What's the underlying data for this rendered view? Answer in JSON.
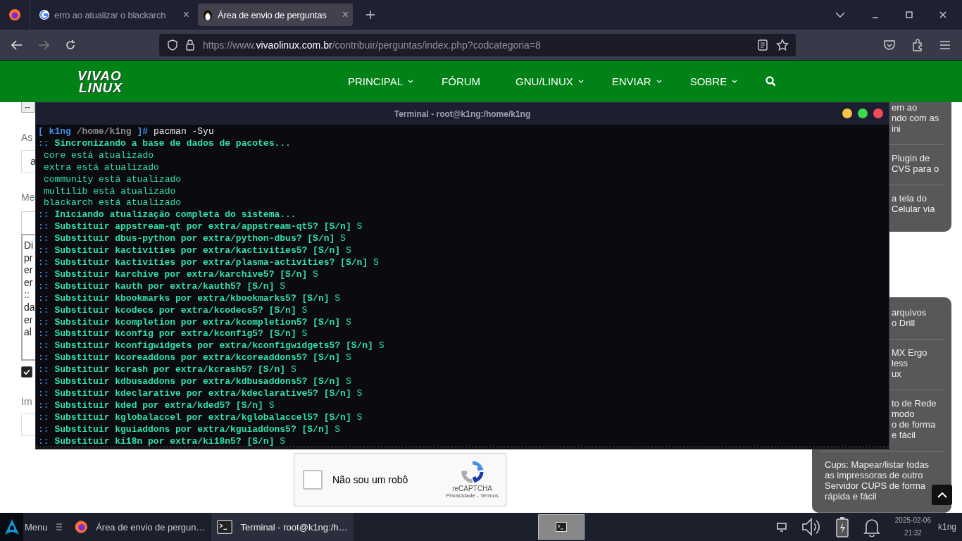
{
  "browser": {
    "tabs": [
      {
        "title": "erro ao atualizar o blackarch",
        "close": "×",
        "selected": false
      },
      {
        "title": "Área de envio de perguntas",
        "close": "×",
        "selected": true
      }
    ],
    "url": {
      "prefix": "https://www.",
      "domain": "vivaolinux.com.br",
      "path": "/contribuir/perguntas/index.php?codcategoria=8"
    }
  },
  "site": {
    "logo": [
      "VIVAO",
      "LINUX"
    ],
    "nav": [
      {
        "label": "PRINCIPAL",
        "dropdown": true
      },
      {
        "label": "FÓRUM",
        "dropdown": false
      },
      {
        "label": "GNU/LINUX",
        "dropdown": true
      },
      {
        "label": "ENVIAR",
        "dropdown": true
      },
      {
        "label": "SOBRE",
        "dropdown": true
      }
    ]
  },
  "form": {
    "select_value": "--",
    "subject_label": "As",
    "subject_value": "a",
    "message_label": "Me",
    "message_lines": [
      "Di",
      "pr",
      "er",
      "er",
      "::",
      "da",
      "er",
      "al"
    ],
    "include_checked": true,
    "images_label": "Im"
  },
  "captcha": {
    "label": "Não sou um robô",
    "brand": "reCAPTCHA",
    "links": "Privacidade - Termos",
    "checked": false
  },
  "sidebar": [
    {
      "items": [
        {
          "lines": [
            "em ao",
            "ndo com as",
            "ini"
          ]
        },
        {
          "lines": [
            "Plugin de",
            "CVS para o"
          ]
        },
        {
          "lines": [
            "a tela do",
            "Celular via"
          ]
        }
      ]
    },
    {
      "items": [
        {
          "lines": [
            "arquivos",
            "o Drill"
          ]
        },
        {
          "lines": [
            "MX Ergo",
            "less",
            "ux"
          ]
        },
        {
          "lines": [
            "to de Rede",
            "modo",
            "o de forma",
            "e fácil"
          ]
        },
        {
          "lines": [
            "Cups: Mapear/listar todas",
            "as impressoras de outro",
            "Servidor CUPS de forma",
            "rápida e fácil"
          ]
        }
      ]
    }
  ],
  "terminal": {
    "title": "Terminal - root@k1ng:/home/k1ng",
    "lines": [
      {
        "kind": "prompt",
        "open": "[",
        "user": "k1ng",
        "path": "/home/k1ng",
        "close": "]#",
        "command": "pacman -Syu"
      },
      {
        "kind": "heading",
        "marker": "::",
        "text": "Sincronizando a base de dados de pacotes..."
      },
      {
        "kind": "info",
        "text": "core está atualizado"
      },
      {
        "kind": "info",
        "text": "extra está atualizado"
      },
      {
        "kind": "info",
        "text": "community está atualizado"
      },
      {
        "kind": "info",
        "text": "multilib está atualizado"
      },
      {
        "kind": "info",
        "text": "blackarch está atualizado"
      },
      {
        "kind": "heading",
        "marker": "::",
        "text": "Iniciando atualização completa do sistema..."
      },
      {
        "kind": "question",
        "marker": "::",
        "text": "Substituir appstream-qt por extra/appstream-qt5? [S/n]",
        "answer": "S"
      },
      {
        "kind": "question",
        "marker": "::",
        "text": "Substituir dbus-python por extra/python-dbus? [S/n]",
        "answer": "S"
      },
      {
        "kind": "question",
        "marker": "::",
        "text": "Substituir kactivities por extra/kactivities5? [S/n]",
        "answer": "S"
      },
      {
        "kind": "question",
        "marker": "::",
        "text": "Substituir kactivities por extra/plasma-activities? [S/n]",
        "answer": "S"
      },
      {
        "kind": "question",
        "marker": "::",
        "text": "Substituir karchive por extra/karchive5? [S/n]",
        "answer": "S"
      },
      {
        "kind": "question",
        "marker": "::",
        "text": "Substituir kauth por extra/kauth5? [S/n]",
        "answer": "S"
      },
      {
        "kind": "question",
        "marker": "::",
        "text": "Substituir kbookmarks por extra/kbookmarks5? [S/n]",
        "answer": "S"
      },
      {
        "kind": "question",
        "marker": "::",
        "text": "Substituir kcodecs por extra/kcodecs5? [S/n]",
        "answer": "S"
      },
      {
        "kind": "question",
        "marker": "::",
        "text": "Substituir kcompletion por extra/kcompletion5? [S/n]",
        "answer": "S"
      },
      {
        "kind": "question",
        "marker": "::",
        "text": "Substituir kconfig por extra/kconfig5? [S/n]",
        "answer": "S"
      },
      {
        "kind": "question",
        "marker": "::",
        "text": "Substituir kconfigwidgets por extra/kconfigwidgets5? [S/n]",
        "answer": "S"
      },
      {
        "kind": "question",
        "marker": "::",
        "text": "Substituir kcoreaddons por extra/kcoreaddons5? [S/n]",
        "answer": "S"
      },
      {
        "kind": "question",
        "marker": "::",
        "text": "Substituir kcrash por extra/kcrash5? [S/n]",
        "answer": "S"
      },
      {
        "kind": "question",
        "marker": "::",
        "text": "Substituir kdbusaddons por extra/kdbusaddons5? [S/n]",
        "answer": "S"
      },
      {
        "kind": "question",
        "marker": "::",
        "text": "Substituir kdeclarative por extra/kdeclarative5? [S/n]",
        "answer": "S"
      },
      {
        "kind": "question",
        "marker": "::",
        "text": "Substituir kded por extra/kded5? [S/n]",
        "answer": "S"
      },
      {
        "kind": "question",
        "marker": "::",
        "text": "Substituir kglobalaccel por extra/kglobalaccel5? [S/n]",
        "answer": "S"
      },
      {
        "kind": "question",
        "marker": "::",
        "text": "Substituir kguiaddons por extra/kguiaddons5? [S/n]",
        "answer": "S"
      },
      {
        "kind": "question",
        "marker": "::",
        "text": "Substituir ki18n por extra/ki18n5? [S/n]",
        "answer": "S"
      }
    ]
  },
  "taskbar": {
    "menu": "Menu",
    "tasks": [
      {
        "title": "Área de envio de pergun…",
        "selected": false
      },
      {
        "title": "Terminal - root@k1ng:/h…",
        "selected": true
      }
    ],
    "date": "2025-02-06",
    "time": "21:32",
    "user": "k1ng"
  }
}
